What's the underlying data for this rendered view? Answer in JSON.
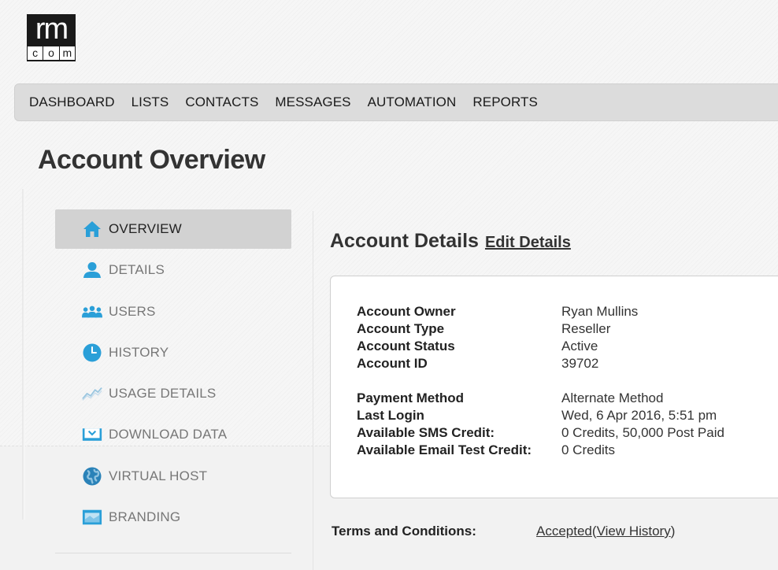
{
  "logo": {
    "top": "rm",
    "bottom": [
      "c",
      "o",
      "m"
    ]
  },
  "nav": [
    {
      "label": "DASHBOARD"
    },
    {
      "label": "LISTS"
    },
    {
      "label": "CONTACTS"
    },
    {
      "label": "MESSAGES"
    },
    {
      "label": "AUTOMATION"
    },
    {
      "label": "REPORTS"
    }
  ],
  "page": {
    "title": "Account Overview"
  },
  "sidebar": {
    "items": [
      {
        "label": "OVERVIEW",
        "icon": "home-icon",
        "active": true
      },
      {
        "label": "DETAILS",
        "icon": "user-icon"
      },
      {
        "label": "USERS",
        "icon": "users-icon"
      },
      {
        "label": "HISTORY",
        "icon": "clock-icon"
      },
      {
        "label": "USAGE DETAILS",
        "icon": "line-chart-icon"
      },
      {
        "label": "DOWNLOAD DATA",
        "icon": "download-icon"
      },
      {
        "label": "VIRTUAL HOST",
        "icon": "globe-icon"
      },
      {
        "label": "BRANDING",
        "icon": "branding-icon"
      }
    ]
  },
  "details": {
    "title": "Account Details",
    "edit_label": "Edit Details",
    "group1": [
      {
        "label": "Account Owner",
        "value": "Ryan Mullins"
      },
      {
        "label": "Account Type",
        "value": "Reseller"
      },
      {
        "label": "Account Status",
        "value": "Active"
      },
      {
        "label": "Account ID",
        "value": "39702"
      }
    ],
    "group2": [
      {
        "label": "Payment Method",
        "value": "Alternate Method"
      },
      {
        "label": "Last Login",
        "value": "Wed, 6 Apr 2016, 5:51 pm"
      },
      {
        "label": "Available SMS Credit:",
        "value": "0 Credits, 50,000 Post Paid"
      },
      {
        "label": "Available Email Test Credit:",
        "value": "0 Credits"
      }
    ]
  },
  "terms": {
    "label": "Terms and Conditions:",
    "accepted": "Accepted",
    "paren_open": "(",
    "history": "View History",
    "paren_close": ")"
  },
  "colors": {
    "icon_blue": "#2a9fd8",
    "active_bg": "#d2d2d2"
  }
}
